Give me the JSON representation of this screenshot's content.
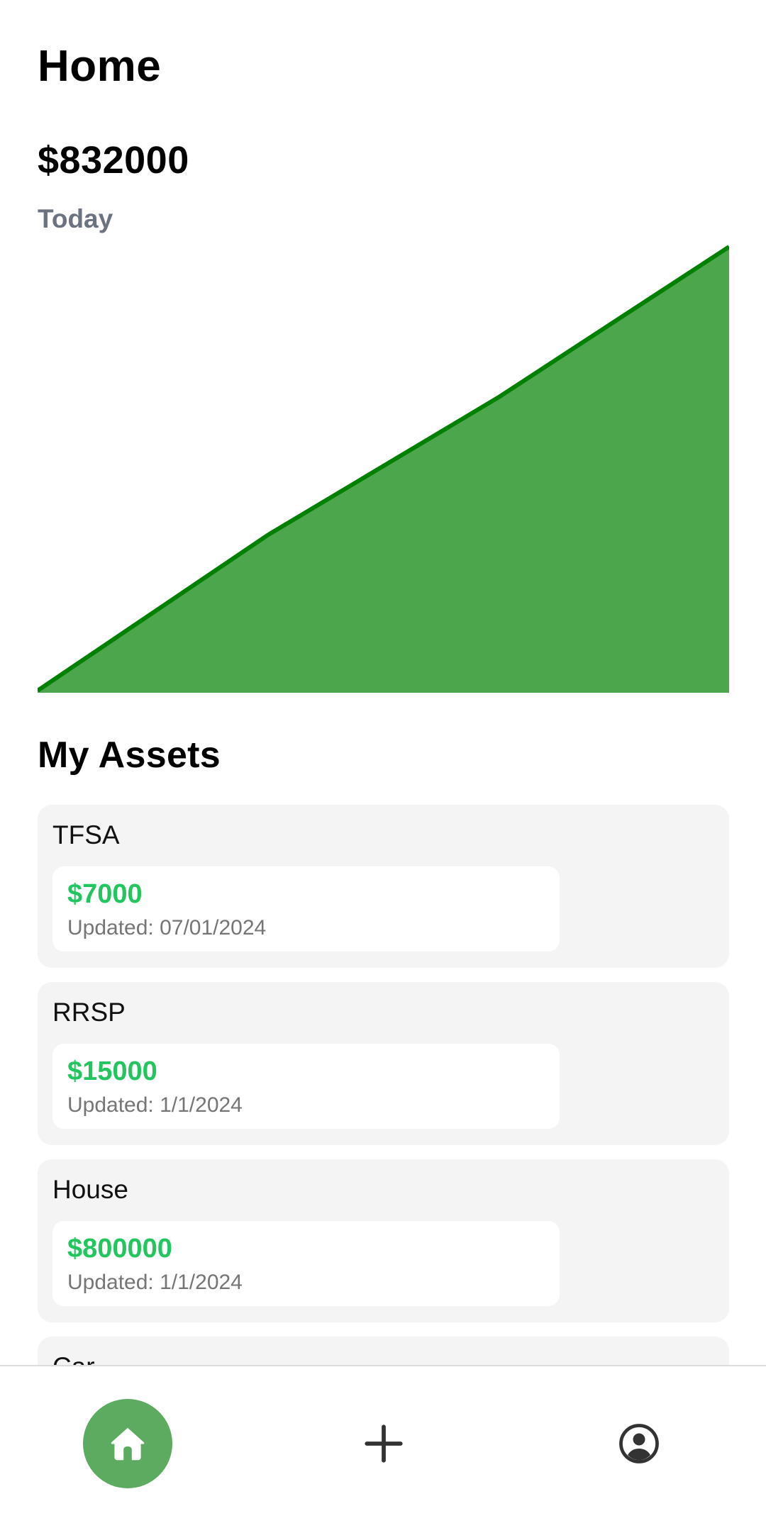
{
  "header": {
    "title": "Home",
    "balance": "$832000",
    "period": "Today"
  },
  "chart_data": {
    "type": "area",
    "x": [
      0,
      1,
      2,
      3
    ],
    "values": [
      0,
      292000,
      550000,
      832000
    ],
    "ylim": [
      0,
      832000
    ],
    "line_color": "#008000",
    "fill_color": "#4ca64c",
    "grid": false,
    "legend": "none"
  },
  "assets": {
    "title": "My Assets",
    "items": [
      {
        "name": "TFSA",
        "value": "$7000",
        "updated": "Updated: 07/01/2024"
      },
      {
        "name": "RRSP",
        "value": "$15000",
        "updated": "Updated: 1/1/2024"
      },
      {
        "name": "House",
        "value": "$800000",
        "updated": "Updated: 1/1/2024"
      },
      {
        "name": "Car",
        "value": "",
        "updated": ""
      }
    ]
  },
  "nav": {
    "items": [
      {
        "icon": "home-icon",
        "active": true
      },
      {
        "icon": "plus-icon",
        "active": false
      },
      {
        "icon": "user-circle-icon",
        "active": false
      }
    ]
  },
  "colors": {
    "accent": "#5cab61",
    "value_green": "#22c55e",
    "muted": "#6b7280",
    "card_bg": "#f4f4f4"
  }
}
